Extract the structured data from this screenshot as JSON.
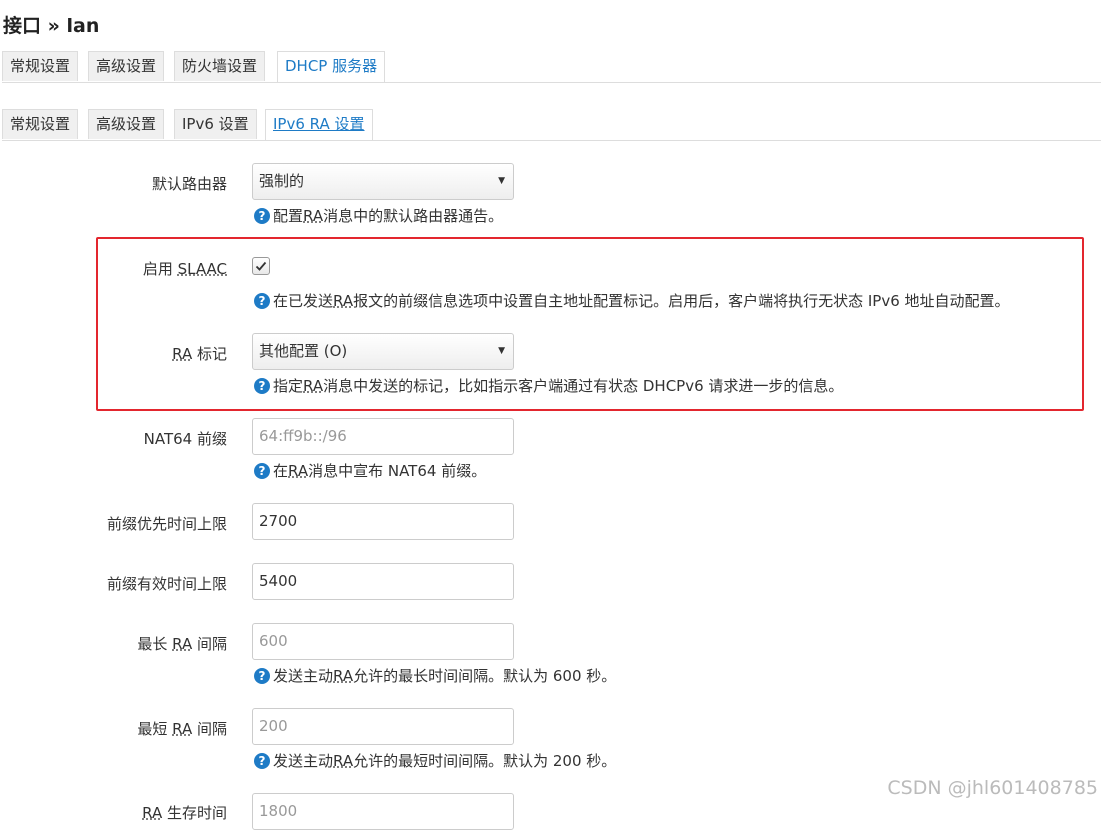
{
  "page": {
    "title": "接口 » lan"
  },
  "tabs_main": [
    {
      "label": "常规设置"
    },
    {
      "label": "高级设置"
    },
    {
      "label": "防火墙设置"
    },
    {
      "label": "DHCP 服务器"
    }
  ],
  "tabs_sub": [
    {
      "label": "常规设置"
    },
    {
      "label": "高级设置"
    },
    {
      "label": "IPv6 设置"
    },
    {
      "label": "IPv6 RA 设置"
    }
  ],
  "form": {
    "default_router": {
      "label": "默认路由器",
      "value": "强制的",
      "help_pre": "配置 ",
      "help_abbr": "RA",
      "help_post": " 消息中的默认路由器通告。"
    },
    "slaac": {
      "label_pre": "启用 ",
      "label_abbr": "SLAAC",
      "checked": true,
      "help_pre": "在已发送 ",
      "help_abbr": "RA",
      "help_post": " 报文的前缀信息选项中设置自主地址配置标记。启用后，客户端将执行无状态 IPv6 地址自动配置。"
    },
    "ra_flags": {
      "label_abbr": "RA",
      "label_post": " 标记",
      "value": "其他配置 (O)",
      "help_pre": "指定 ",
      "help_abbr": "RA",
      "help_post": " 消息中发送的标记，比如指示客户端通过有状态 DHCPv6 请求进一步的信息。"
    },
    "nat64": {
      "label": "NAT64 前缀",
      "placeholder": "64:ff9b::/96",
      "help_pre": "在 ",
      "help_abbr": "RA",
      "help_post": " 消息中宣布 NAT64 前缀。"
    },
    "pref_lifetime": {
      "label": "前缀优先时间上限",
      "value": "2700"
    },
    "valid_lifetime": {
      "label": "前缀有效时间上限",
      "value": "5400"
    },
    "max_interval": {
      "label_pre": "最长 ",
      "label_abbr": "RA",
      "label_post": " 间隔",
      "placeholder": "600",
      "help_pre": "发送主动 ",
      "help_abbr": "RA",
      "help_post": " 允许的最长时间间隔。默认为 600 秒。"
    },
    "min_interval": {
      "label_pre": "最短 ",
      "label_abbr": "RA",
      "label_post": " 间隔",
      "placeholder": "200",
      "help_pre": "发送主动 ",
      "help_abbr": "RA",
      "help_post": " 允许的最短时间间隔。默认为 200 秒。"
    },
    "ra_lifetime": {
      "label_abbr": "RA",
      "label_post": " 生存时间",
      "placeholder": "1800"
    }
  },
  "icons": {
    "help": "question-circle-icon",
    "check": "checkmark-icon",
    "caret": "caret-down-icon"
  },
  "colors": {
    "accent": "#1e7bc6",
    "highlight_border": "#e3262e"
  },
  "watermark": "CSDN @jhl601408785"
}
